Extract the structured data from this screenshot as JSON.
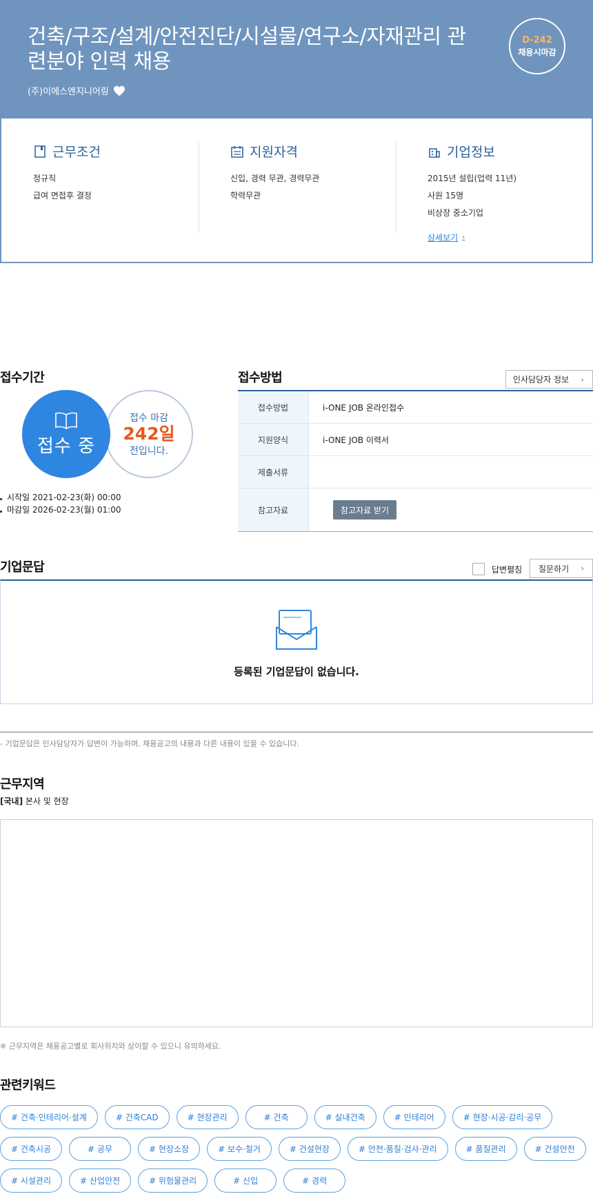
{
  "header": {
    "title": "건축/구조/설계/안전진단/시설물/연구소/자재관리 관련분야 인력 채용",
    "company": "(주)이에스엔지니어링",
    "dday": "D-242",
    "dday_label": "채용시마감"
  },
  "summary": {
    "work": {
      "title": "근무조건",
      "lines": [
        "정규직",
        "급여 면접후 결정"
      ]
    },
    "qualification": {
      "title": "지원자격",
      "lines": [
        "신입, 경력 무관, 경력무관",
        "학력무관"
      ]
    },
    "company": {
      "title": "기업정보",
      "lines": [
        "2015년 설립(업력 11년)",
        "사원 15명",
        "비상장 중소기업"
      ],
      "link": "상세보기"
    }
  },
  "period": {
    "title": "접수기간",
    "status": "접수 중",
    "until_top": "접수 마감",
    "until_days": "242일",
    "until_bottom": "전입니다.",
    "start": "시작일 2021-02-23(화) 00:00",
    "end": "마감일 2026-02-23(월) 01:00"
  },
  "method": {
    "title": "접수방법",
    "hr_button": "인사담당자 정보",
    "rows": [
      {
        "label": "접수방법",
        "value": "i-ONE JOB 온라인접수"
      },
      {
        "label": "지원양식",
        "value": "i-ONE JOB 이력서"
      },
      {
        "label": "제출서류",
        "value": ""
      },
      {
        "label": "참고자료",
        "button": "참고자료 받기"
      }
    ]
  },
  "qa": {
    "title": "기업문답",
    "expand_label": "답변펼침",
    "ask_button": "질문하기",
    "empty": "등록된 기업문답이 없습니다.",
    "note": "- 기업문답은 인사담당자가 답변이 가능하며, 채용공고의 내용과 다른 내용이 있을 수 있습니다."
  },
  "location": {
    "title": "근무지역",
    "tag": "[국내]",
    "place": " 본사 및 현장",
    "note": "※ 근무지역은 채용공고별로 회사위치와 상이할 수 있으니 유의하세요."
  },
  "keywords": {
    "title": "관련키워드",
    "rows": [
      [
        "# 건축·인테리어·설계",
        "# 건축CAD",
        "# 현장관리",
        "# 건축",
        "# 실내건축",
        "# 인테리어",
        "# 현장·시공·감리·공무"
      ],
      [
        "# 건축시공",
        "# 공무",
        "# 현장소장",
        "# 보수·철거",
        "# 건설현장",
        "# 안전·품질·검사·관리",
        "# 품질관리",
        "# 건설안전"
      ],
      [
        "# 시설관리",
        "# 산업안전",
        "# 위험물관리",
        "# 신입",
        "# 경력"
      ]
    ]
  },
  "colors": {
    "header_bg": "#6f95bf",
    "accent_blue": "#2f86e0",
    "accent_orange": "#e9571f",
    "navy": "#2c5e9a"
  }
}
